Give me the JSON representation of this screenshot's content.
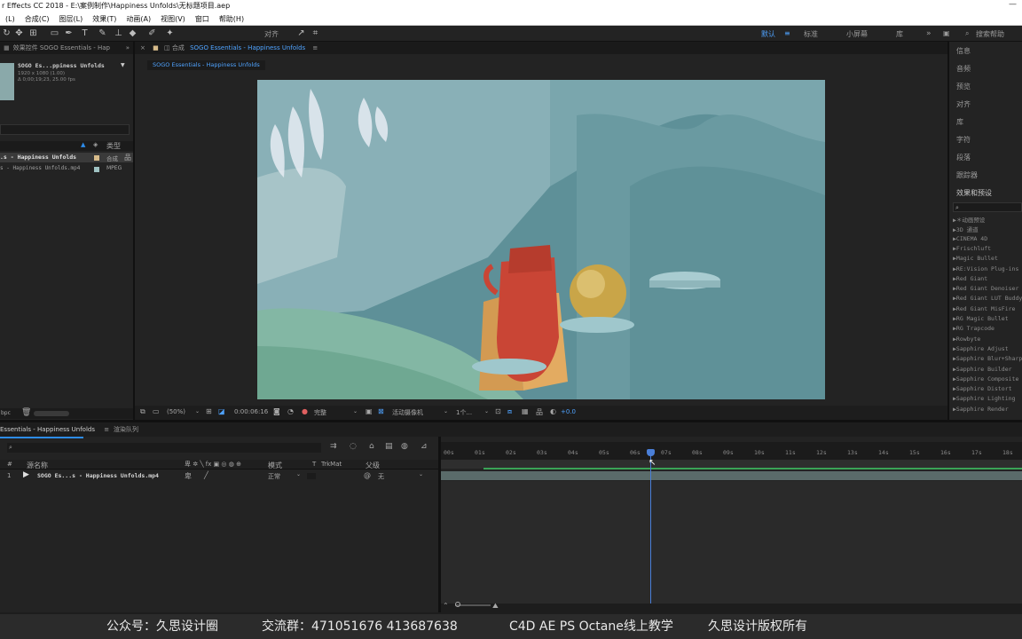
{
  "window": {
    "title": "r Effects CC 2018 - E:\\案例制作\\Happiness Unfolds\\无标题项目.aep"
  },
  "menu": [
    "(L)",
    "合成(C)",
    "图层(L)",
    "效果(T)",
    "动画(A)",
    "视图(V)",
    "窗口",
    "帮助(H)"
  ],
  "toolbar": {
    "snap_label": "对齐",
    "workspaces": [
      "默认",
      "标准",
      "小屏幕",
      "库"
    ],
    "search_placeholder": "搜索帮助"
  },
  "project": {
    "header": "效果控件 SOGO Essentials - Hap",
    "item_name": "SOGO Es...ppiness Unfolds",
    "item_info1": "1920 x 1080 (1.00)",
    "item_info2": "Δ 0;00;19;23, 25.00 fps",
    "col_type": "类型",
    "rows": [
      {
        "name": ".s - Happiness Unfolds",
        "type": "合成"
      },
      {
        "name": "s - Happiness Unfolds.mp4",
        "type": "MPEG"
      }
    ],
    "bpc": "bpc"
  },
  "viewer": {
    "tab_label": "合成",
    "comp_name": "SOGO Essentials - Happiness Unfolds",
    "sub_tab": "SOGO Essentials - Happiness Unfolds",
    "zoom": "(50%)",
    "timecode": "0:00:06:16",
    "quality": "完整",
    "camera": "活动摄像机",
    "views": "1个...",
    "exposure": "+0.0"
  },
  "right_panel": {
    "items": [
      "信息",
      "音频",
      "预览",
      "对齐",
      "库",
      "字符",
      "段落",
      "跟踪器",
      "效果和预设"
    ],
    "effects": [
      "▶＊动画预设",
      "▶3D 通道",
      "▶CINEMA 4D",
      "▶Frischluft",
      "▶Magic Bullet",
      "▶RE:Vision Plug-ins",
      "▶Red Giant",
      "▶Red Giant Denoiser",
      "▶Red Giant LUT Buddy",
      "▶Red Giant MisFire",
      "▶RG Magic Bullet",
      "▶RG Trapcode",
      "▶Rowbyte",
      "▶Sapphire Adjust",
      "▶Sapphire Blur+Sharpen",
      "▶Sapphire Builder",
      "▶Sapphire Composite",
      "▶Sapphire Distort",
      "▶Sapphire Lighting",
      "▶Sapphire Render"
    ]
  },
  "timeline": {
    "tab_label": "Essentials - Happiness Unfolds",
    "render_queue": "渲染队列",
    "col_num": "#",
    "col_source": "源名称",
    "col_mode": "模式",
    "col_t": "T",
    "col_trkmat": "TrkMat",
    "col_parent": "父级",
    "layer": {
      "num": "1",
      "name": "SOGO Es...s - Happiness Unfolds.mp4",
      "mode": "正常",
      "parent": "无"
    },
    "ruler": [
      "00s",
      "01s",
      "02s",
      "03s",
      "04s",
      "05s",
      "06s",
      "07s",
      "08s",
      "09s",
      "10s",
      "11s",
      "12s",
      "13s",
      "14s",
      "15s",
      "16s",
      "17s",
      "18s"
    ]
  },
  "watermark": {
    "account": "公众号：久思设计圈",
    "group": "交流群：471051676   413687638",
    "course": "C4D AE PS Octane线上教学",
    "copyright": "久思设计版权所有"
  },
  "colors": {
    "accent": "#2d8ceb",
    "playhead": "#4a7fd8",
    "layer_bar": "#5a6b6a"
  }
}
